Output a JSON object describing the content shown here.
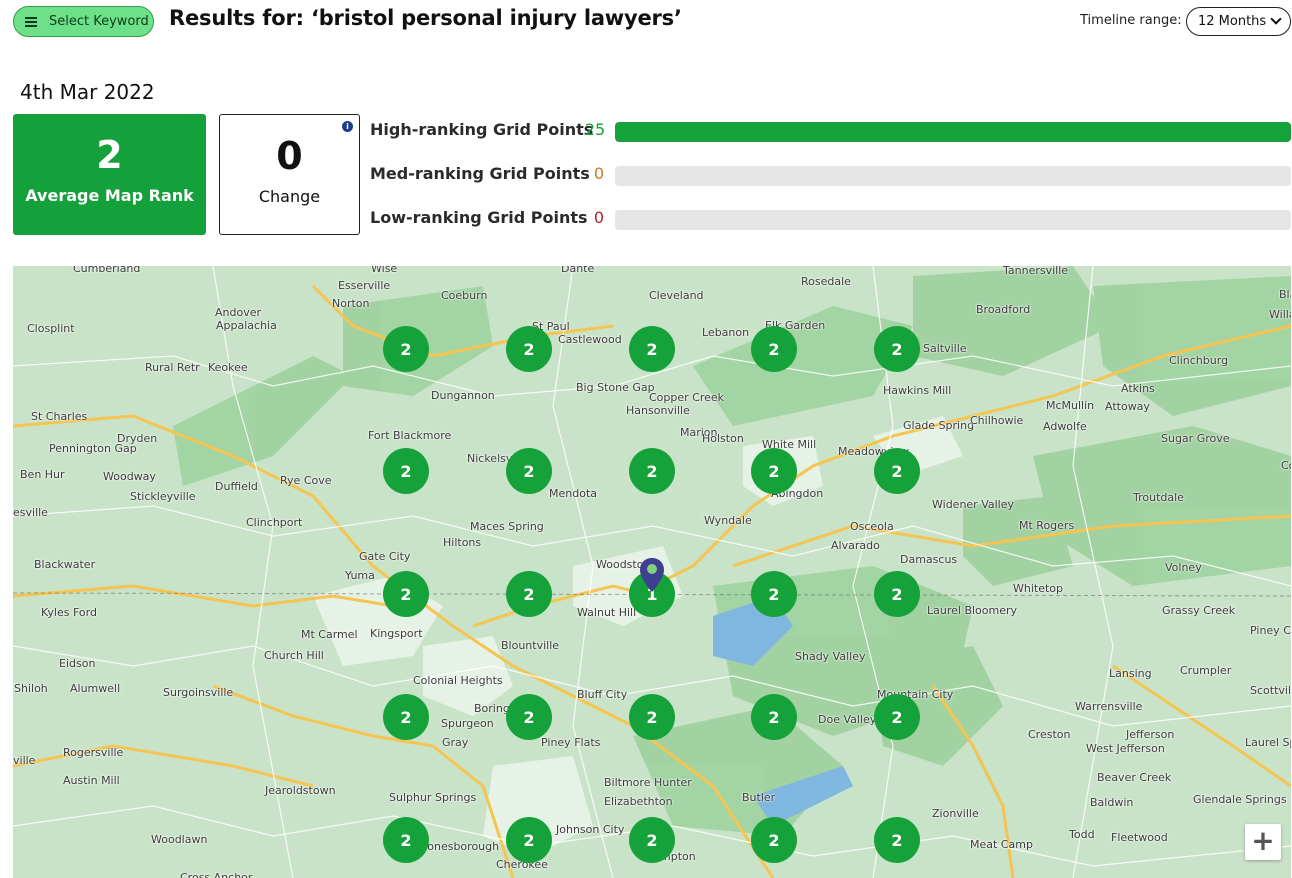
{
  "header": {
    "select_keyword_label": "Select Keyword",
    "title": "Results for: ‘bristol personal injury lawyers’",
    "timeline_label": "Timeline range:",
    "timeline_value": "12 Months"
  },
  "date": "4th Mar 2022",
  "stats": {
    "average_rank": "2",
    "average_rank_label": "Average Map Rank",
    "change": "0",
    "change_label": "Change",
    "info_icon": "i"
  },
  "grid_points": [
    {
      "label": "High-ranking Grid Points",
      "count": "25",
      "fraction": 1.0,
      "color": "#16a23a"
    },
    {
      "label": "Med-ranking Grid Points",
      "count": "0",
      "fraction": 0.0,
      "color": "#c9772b"
    },
    {
      "label": "Low-ranking Grid Points",
      "count": "0",
      "fraction": 0.0,
      "color": "#b22222"
    }
  ],
  "map": {
    "ranks": [
      [
        "2",
        "2",
        "2",
        "2",
        "2"
      ],
      [
        "2",
        "2",
        "2",
        "2",
        "2"
      ],
      [
        "2",
        "2",
        "1",
        "2",
        "2"
      ],
      [
        "2",
        "2",
        "2",
        "2",
        "2"
      ],
      [
        "2",
        "2",
        "2",
        "2",
        "2"
      ]
    ],
    "place_labels": [
      "Cumberland",
      "Wise",
      "Dante",
      "Tannersville",
      "Esserville",
      "Coeburn",
      "Cleveland",
      "Rosedale",
      "Black",
      "Norton",
      "Andover",
      "Appalachia",
      "St Paul",
      "Castlewood",
      "Lebanon",
      "Elk Garden",
      "Broadford",
      "Saltville",
      "Willard",
      "Closplint",
      "Rural Retr",
      "Keokee",
      "Big Stone Gap",
      "Copper Creek",
      "Hansonville",
      "Hawkins Mill",
      "Clinchburg",
      "Atkins",
      "Marion",
      "Dungannon",
      "St Charles",
      "McMullin",
      "Attoway",
      "Fort Blackmore",
      "Holston",
      "White Mill",
      "Meadowview",
      "Glade Spring",
      "Chilhowie",
      "Adwolfe",
      "Sugar Grove",
      "Dryden",
      "Pennington Gap",
      "Nickelsville",
      "Ben Hur",
      "Woodway",
      "Duffield",
      "Rye Cove",
      "Mendota",
      "Abingdon",
      "Stickleyville",
      "Com",
      "Troutdale",
      "esville",
      "Clinchport",
      "Wyndale",
      "Widener Valley",
      "Maces Spring",
      "Osceola",
      "Mt Rogers",
      "Hiltons",
      "Alvarado",
      "Damascus",
      "Gate City",
      "Blackwater",
      "Yuma",
      "Woodstock",
      "Whitetop",
      "Volney",
      "Kyles Ford",
      "Walnut Hill",
      "Laurel Bloomery",
      "Grassy Creek",
      "Piney Creek",
      "Mt Carmel",
      "Kingsport",
      "Church Hill",
      "Blountville",
      "Shady Valley",
      "Eidson",
      "Lansing",
      "Crumpler",
      "Shiloh",
      "Alumwell",
      "Surgoinsville",
      "Colonial Heights",
      "Bluff City",
      "Mountain City",
      "Scottville",
      "Boring",
      "Warrensville",
      "Spurgeon",
      "Gray",
      "Piney Flats",
      "Doe Valley",
      "Creston",
      "Jefferson",
      "Rogersville",
      "West Jefferson",
      "Laurel Sp",
      "ville",
      "Austin Mill",
      "Beaver Creek",
      "Biltmore",
      "Hunter",
      "Jearoldstown",
      "Elizabethton",
      "Butler",
      "Baldwin",
      "Glendale Springs",
      "Sulphur Springs",
      "Zionville",
      "Woodlawn",
      "Johnson City",
      "Jonesborough",
      "Meat Camp",
      "Todd",
      "Fleetwood",
      "Cherokee",
      "Hampton",
      "Cross Anchor"
    ],
    "zoom_in_label": "+",
    "land_color": "#c9e3c8",
    "park_color": "#9fd19e",
    "highway_color": "#f5c451"
  }
}
